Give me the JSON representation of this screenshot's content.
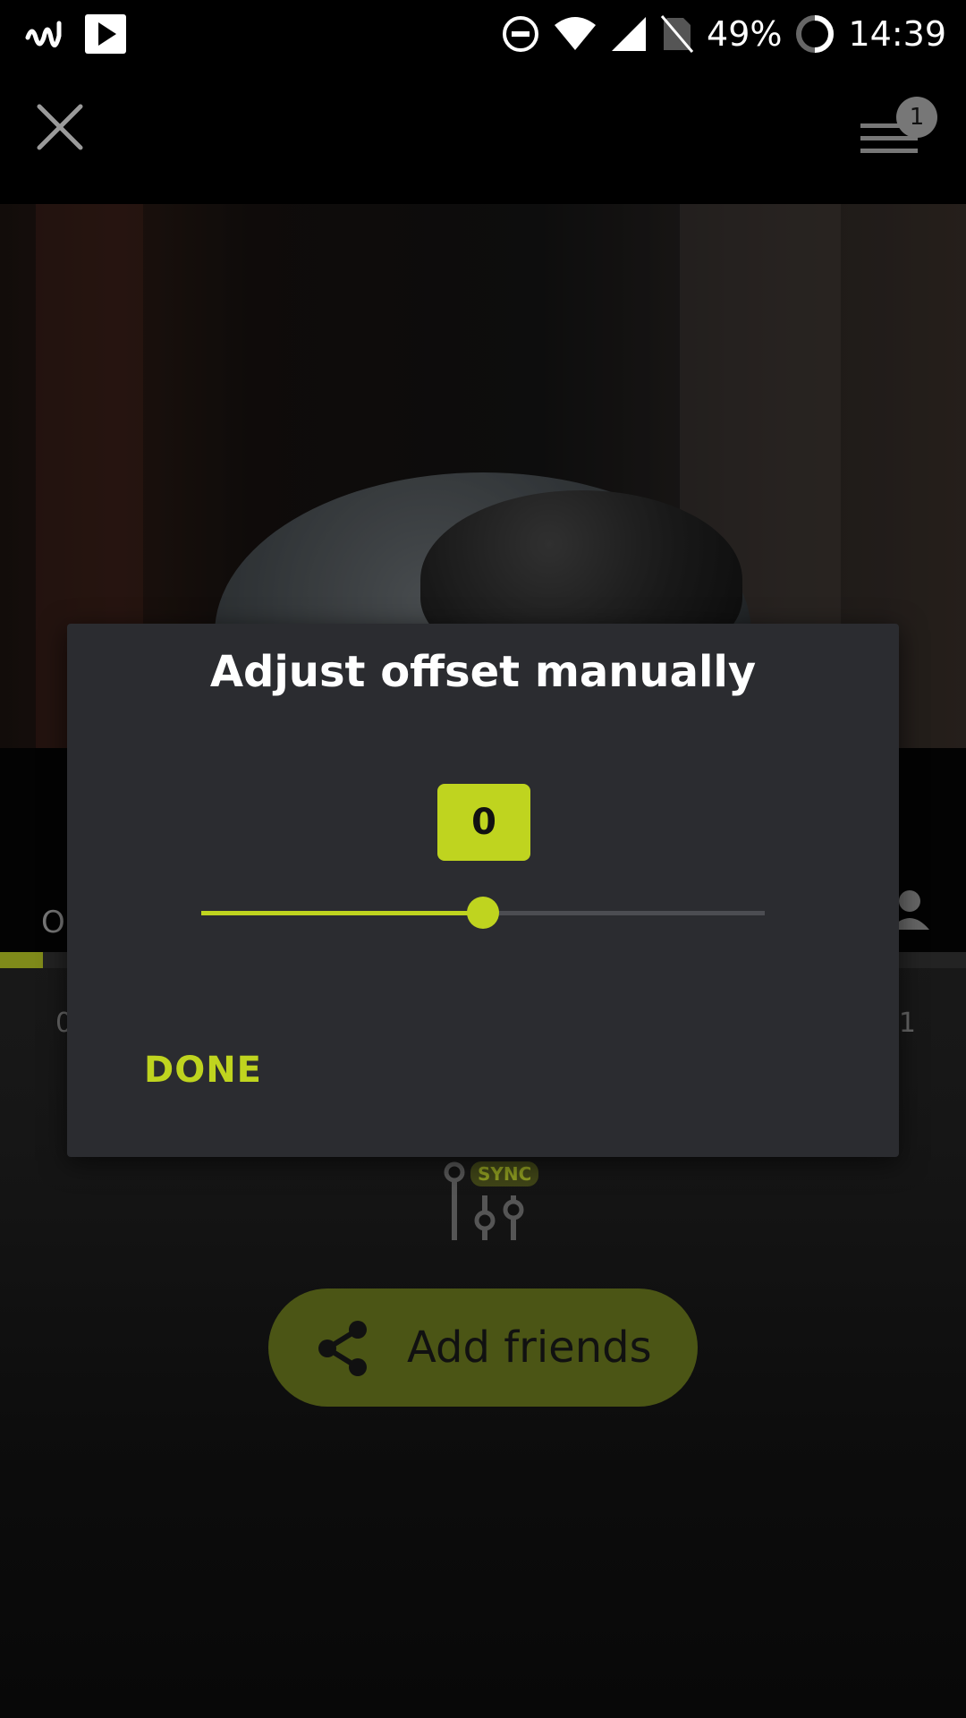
{
  "status_bar": {
    "battery": "49%",
    "time": "14:39",
    "icons": [
      "app-wave-icon",
      "play-store-icon",
      "dnd-icon",
      "wifi-icon",
      "signal-icon",
      "no-sim-icon",
      "battery-icon"
    ]
  },
  "top_bar": {
    "close_icon": "close-icon",
    "queue_icon": "queue-icon",
    "queue_count": "1"
  },
  "background": {
    "tab_left_text": "O",
    "time_left": "0",
    "time_right": "1",
    "sync_label": "SYNC",
    "add_friends_label": "Add friends"
  },
  "dialog": {
    "title": "Adjust offset manually",
    "offset_value": "0",
    "slider_level": 0.5,
    "done_label": "DONE"
  },
  "colors": {
    "accent": "#bfd41f",
    "dialog_bg": "#2b2c30",
    "button_dim": "#4b5515"
  }
}
